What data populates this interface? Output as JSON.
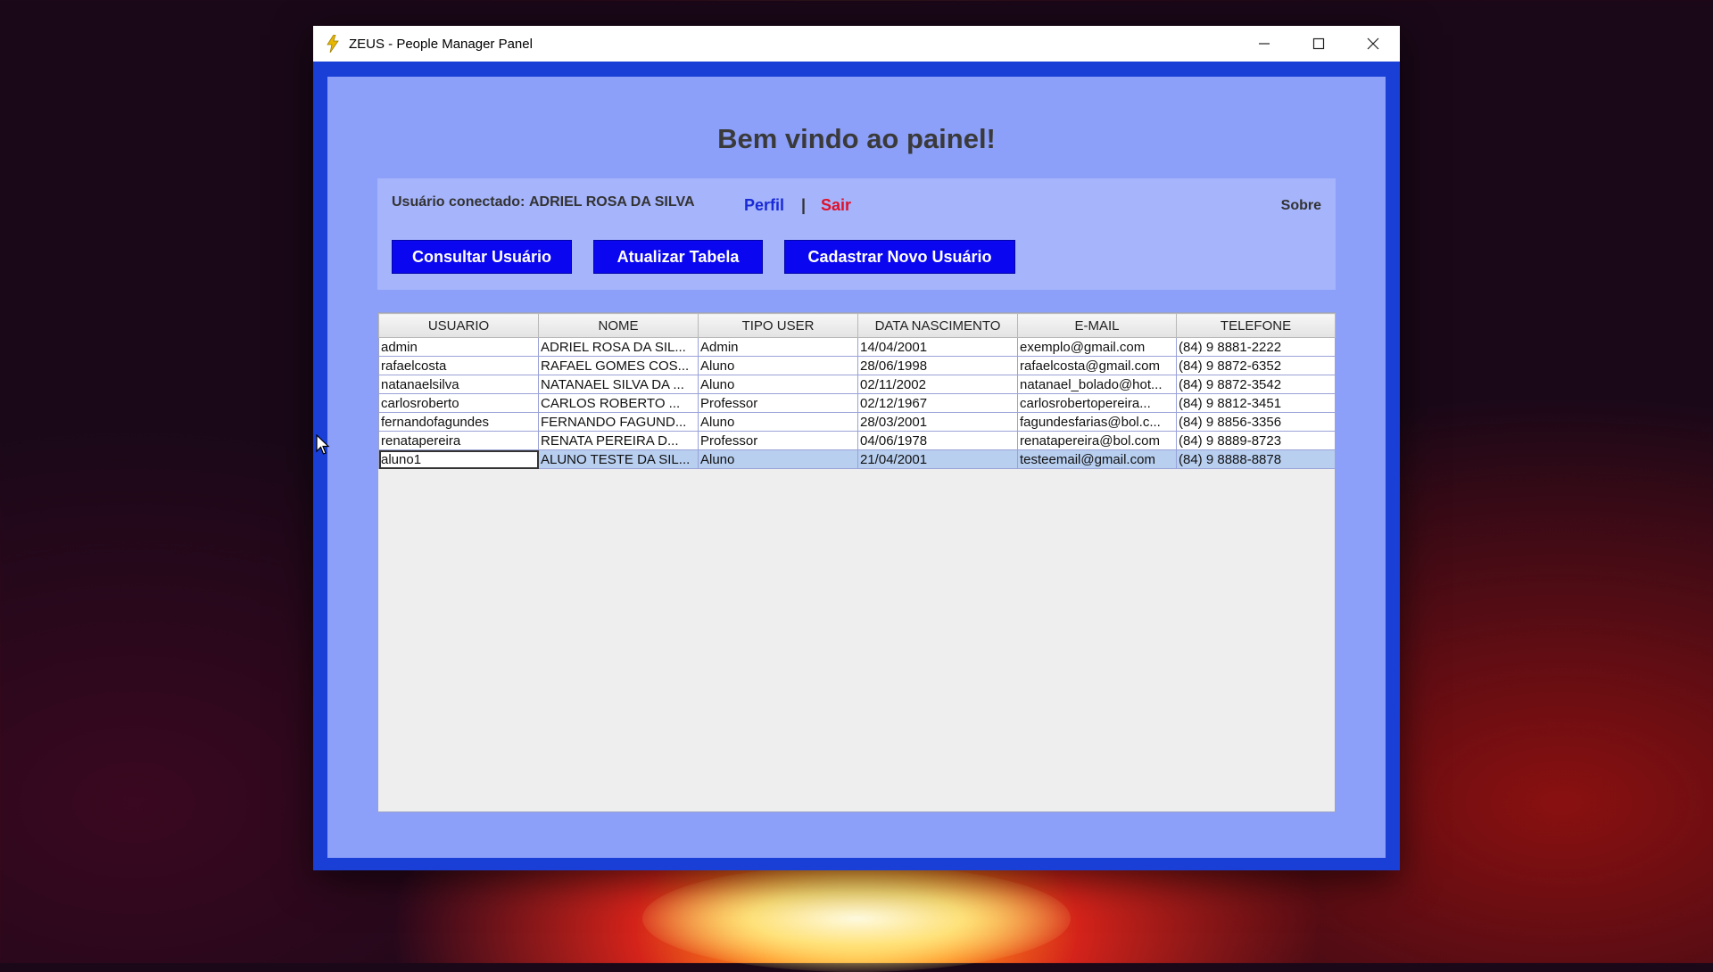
{
  "window": {
    "title": "ZEUS - People Manager Panel",
    "controls": {
      "minimize": "—",
      "maximize": "☐",
      "close": "✕"
    }
  },
  "panel": {
    "welcome": "Bem vindo ao painel!",
    "connected_label": "Usuário conectado:",
    "connected_user": "ADRIEL ROSA DA SILVA",
    "perfil": "Perfil",
    "separator": "|",
    "sair": "Sair",
    "sobre": "Sobre"
  },
  "buttons": {
    "consultar": "Consultar Usuário",
    "atualizar": "Atualizar Tabela",
    "cadastrar": "Cadastrar Novo Usuário"
  },
  "table": {
    "columns": [
      "USUARIO",
      "NOME",
      "TIPO USER",
      "DATA NASCIMENTO",
      "E-MAIL",
      "TELEFONE"
    ],
    "rows": [
      [
        "admin",
        "ADRIEL ROSA DA SIL...",
        "Admin",
        "14/04/2001",
        "exemplo@gmail.com",
        "(84) 9 8881-2222"
      ],
      [
        "rafaelcosta",
        "RAFAEL GOMES COS...",
        "Aluno",
        "28/06/1998",
        "rafaelcosta@gmail.com",
        "(84) 9 8872-6352"
      ],
      [
        "natanaelsilva",
        "NATANAEL SILVA DA ...",
        "Aluno",
        "02/11/2002",
        "natanael_bolado@hot...",
        "(84) 9 8872-3542"
      ],
      [
        "carlosroberto",
        "CARLOS ROBERTO ...",
        "Professor",
        "02/12/1967",
        "carlosrobertopereira...",
        "(84) 9 8812-3451"
      ],
      [
        "fernandofagundes",
        "FERNANDO FAGUND...",
        "Aluno",
        "28/03/2001",
        "fagundesfarias@bol.c...",
        "(84) 9 8856-3356"
      ],
      [
        "renatapereira",
        "RENATA PEREIRA D...",
        "Professor",
        "04/06/1978",
        "renatapereira@bol.com",
        "(84) 9 8889-8723"
      ],
      [
        "aluno1",
        "ALUNO TESTE DA SIL...",
        "Aluno",
        "21/04/2001",
        "testeemail@gmail.com",
        "(84) 9 8888-8878"
      ]
    ],
    "selected_row": 6
  },
  "icons": {
    "app": "lightning-icon",
    "cursor": "mouse-cursor-icon"
  },
  "colors": {
    "frame": "#1a3fd6",
    "panel": "#8c9ff9",
    "button": "#0a06f0",
    "sair": "#e0102a",
    "perfil": "#1a2ad6"
  }
}
